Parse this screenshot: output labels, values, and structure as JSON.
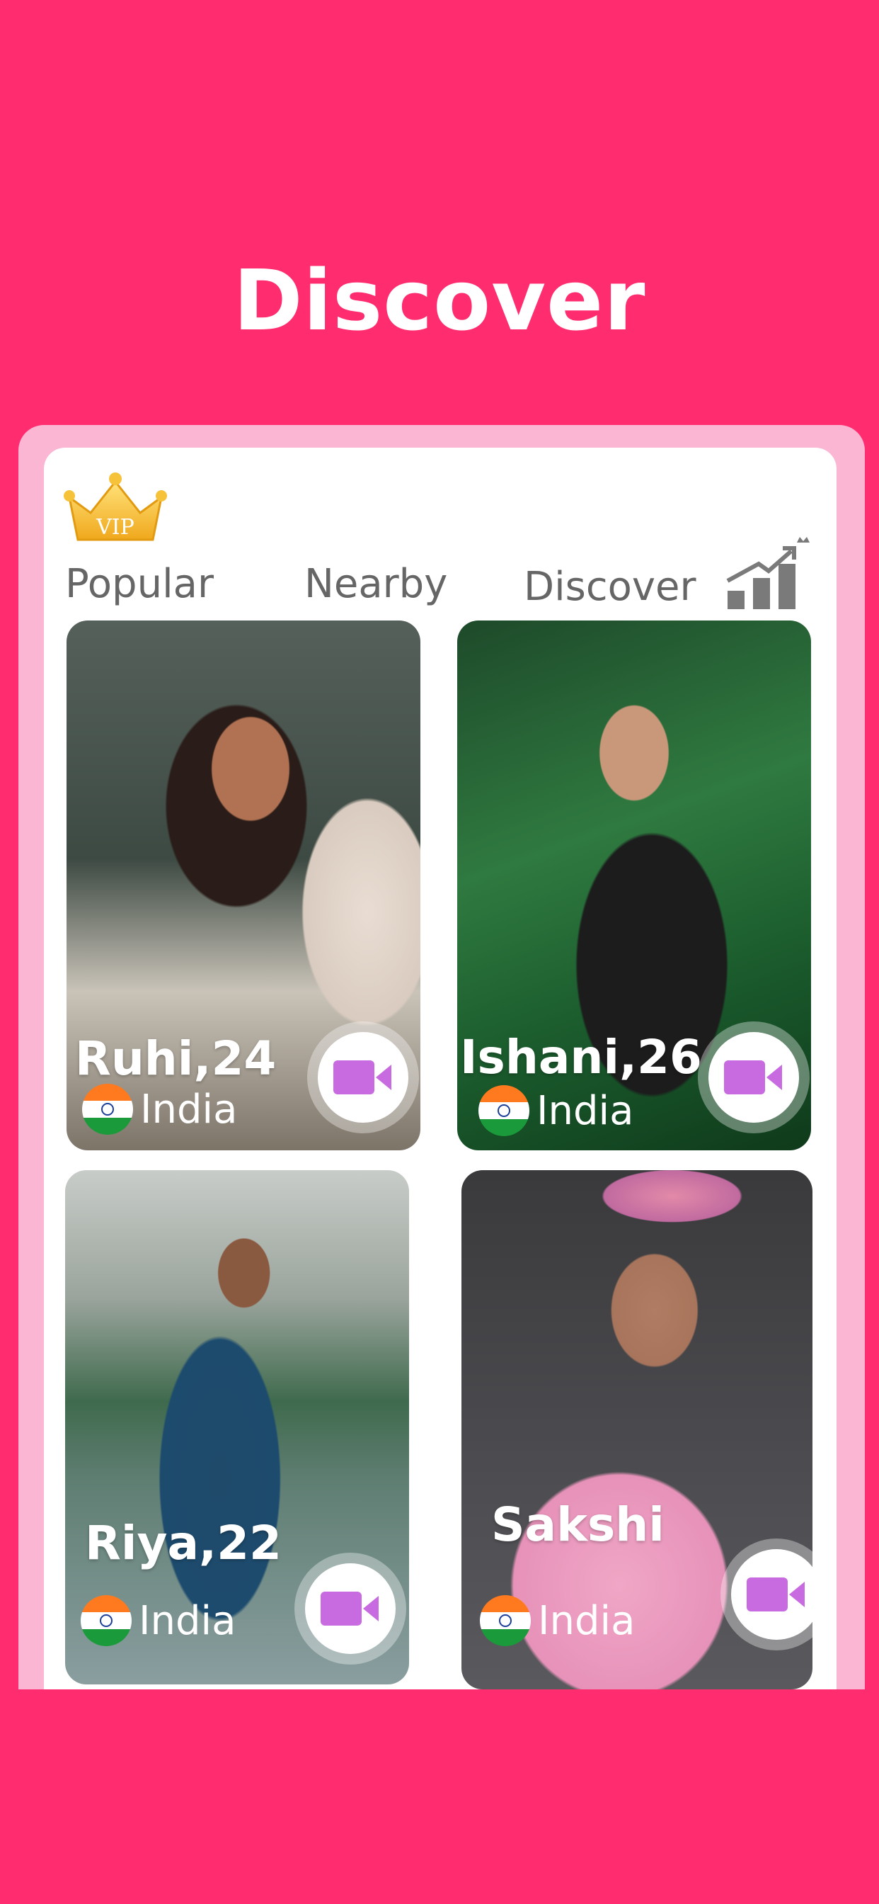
{
  "header": {
    "title": "Discover"
  },
  "vip": {
    "label": "VIP"
  },
  "tabs": [
    {
      "label": "Popular"
    },
    {
      "label": "Nearby"
    },
    {
      "label": "Discover"
    }
  ],
  "cards": [
    {
      "name": "Ruhi,24",
      "country": "India"
    },
    {
      "name": "Ishani,26",
      "country": "India"
    },
    {
      "name": "Riya,22",
      "country": "India"
    },
    {
      "name": "Sakshi",
      "country": "India"
    }
  ],
  "icons": {
    "vip": "crown-icon",
    "ranking": "ranking-chart-icon",
    "flag": "india-flag-icon",
    "call": "video-camera-icon"
  },
  "colors": {
    "background": "#ff2d6f",
    "frame": "#fbb6d3",
    "card_surface": "#ffffff",
    "video_icon": "#c86be0",
    "tab_text": "#666666"
  }
}
